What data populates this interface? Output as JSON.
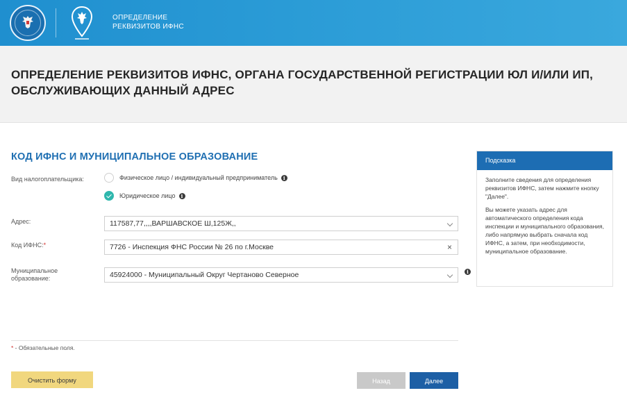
{
  "header": {
    "service_name": "Определение реквизитов ИФНС"
  },
  "page": {
    "title": "Определение реквизитов ИФНС, органа государственной регистрации ЮЛ и/или ИП, обслуживающих данный адрес"
  },
  "form": {
    "section_title": "Код ИФНС и муниципальное образование",
    "taxpayer_type": {
      "label": "Вид налогоплательщика:",
      "options": [
        {
          "label": "Физическое лицо / индивидуальный предприниматель",
          "checked": false
        },
        {
          "label": "Юридическое лицо",
          "checked": true
        }
      ]
    },
    "address": {
      "label": "Адрес:",
      "value": "117587,77,,,,ВАРШАВСКОЕ Ш,125Ж,,"
    },
    "ifns_code": {
      "label": "Код ИФНС:",
      "required_mark": "*",
      "value": "7726 - Инспекция ФНС России № 26 по г.Москве"
    },
    "municipality": {
      "label": "Муниципальное образование:",
      "value": "45924000 - Муниципальный Округ Чертаново Северное"
    },
    "required_note_mark": "*",
    "required_note": " - Обязательные поля.",
    "buttons": {
      "clear": "Очистить форму",
      "back": "Назад",
      "next": "Далее"
    }
  },
  "hint": {
    "title": "Подсказка",
    "paragraphs": [
      "Заполните сведения для определения реквизитов ИФНС, затем нажмите кнопку \"Далее\".",
      "Вы можете указать адрес для автоматического определения кода инспекции и муниципального образования, либо напрямую выбрать сначала код ИФНС, а затем, при необходимости, муниципальное образование."
    ]
  },
  "colors": {
    "header_blue": "#2a9bd6",
    "section_title_blue": "#1f6fb2",
    "hint_header": "#1d6db3",
    "radio_checked": "#2fb7ad",
    "clear_button": "#f1d77e",
    "next_button": "#1d5fa5",
    "back_button_disabled": "#c9c9c9"
  }
}
